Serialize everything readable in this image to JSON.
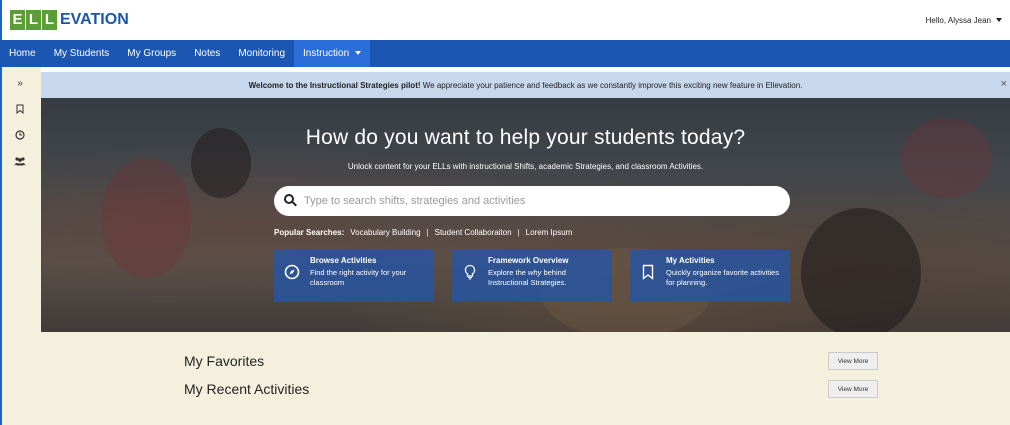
{
  "header": {
    "logo_letters": [
      "E",
      "L",
      "L"
    ],
    "logo_rest": "EVATION",
    "greeting": "Hello, Alyssa Jean"
  },
  "nav": {
    "items": [
      {
        "label": "Home"
      },
      {
        "label": "My Students"
      },
      {
        "label": "My Groups"
      },
      {
        "label": "Notes"
      },
      {
        "label": "Monitoring"
      },
      {
        "label": "Instruction"
      }
    ]
  },
  "sidebar": {
    "icons": [
      "expand-icon",
      "bookmark-icon",
      "clock-icon",
      "group-icon"
    ],
    "expand_glyph": "»"
  },
  "banner": {
    "bold": "Welcome to the Instructional Strategies pilot!",
    "text": " We appreciate your patience and feedback as we constantly improve this exciting new feature in Ellevation.",
    "close": "×"
  },
  "hero": {
    "title": "How do you want to help your students today?",
    "subtitle": "Unlock content for your ELLs with instructional Shifts, academic Strategies, and classroom Activities.",
    "search_placeholder": "Type to search shifts, strategies and activities",
    "popular_label": "Popular Searches:",
    "popular": [
      "Vocabulary Building",
      "Student Collaboraiton",
      "Lorem Ipsum"
    ],
    "separator": "|"
  },
  "cards": [
    {
      "title": "Browse Activities",
      "desc": "Find the right activity for your classroom",
      "icon": "compass-icon"
    },
    {
      "title": "Framework Overview",
      "desc_pre": "Explore the ",
      "desc_em": "why",
      "desc_post": " behind Instructional Strategies.",
      "icon": "lightbulb-icon"
    },
    {
      "title": "My Activities",
      "desc": "Quickly organize favorite activities for planning.",
      "icon": "bookmark-icon"
    }
  ],
  "sections": [
    {
      "title": "My Favorites",
      "button": "View More"
    },
    {
      "title": "My Recent Activities",
      "button": "View More"
    }
  ],
  "colors": {
    "nav": "#1b56b3",
    "banner": "#c7d7ec",
    "cream": "#f5f0de",
    "logo_green": "#5a9e35"
  }
}
